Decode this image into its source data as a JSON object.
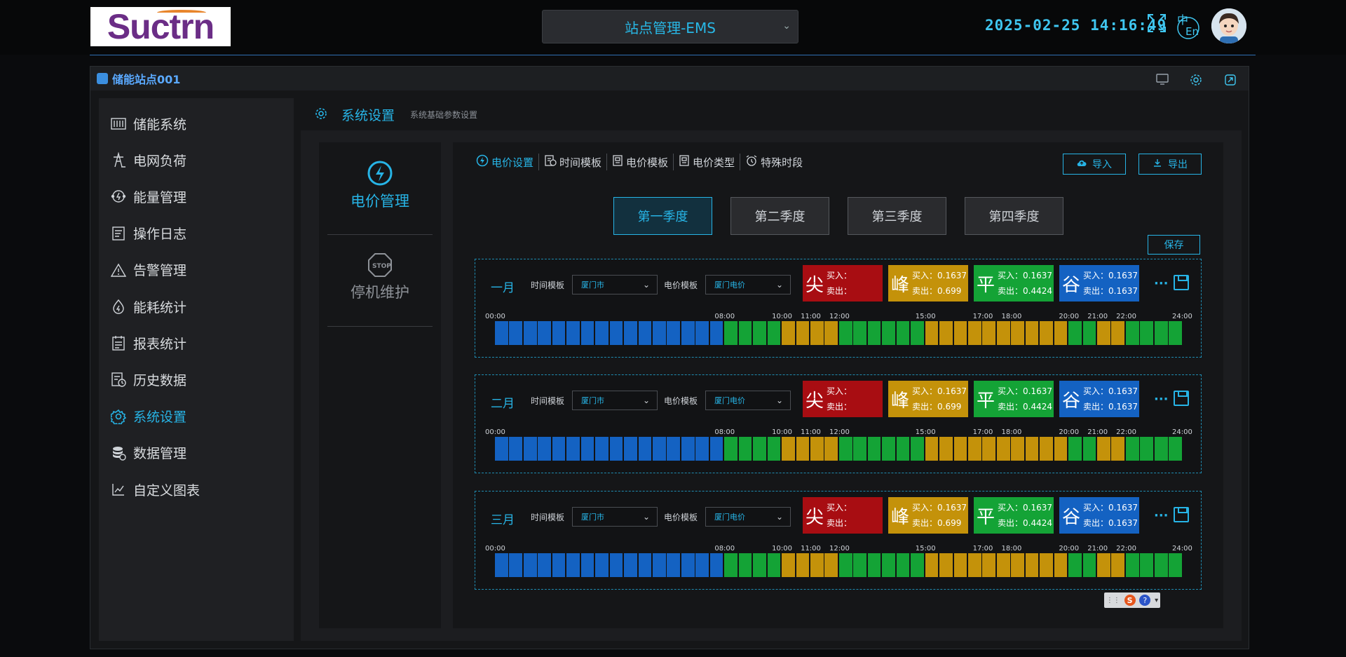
{
  "logo": {
    "text": "Suctrn"
  },
  "header": {
    "site_select": "站点管理-EMS",
    "datetime": "2025-02-25  14:16:49",
    "lang_icon": "中/En",
    "icons": [
      "fullscreen-icon",
      "language-icon",
      "avatar"
    ]
  },
  "station": {
    "title": "储能站点001",
    "icons": [
      "monitor-icon",
      "gear-icon",
      "copy-icon"
    ]
  },
  "sidebar": {
    "items": [
      {
        "label": "储能系统",
        "icon": "battery-icon"
      },
      {
        "label": "电网负荷",
        "icon": "tower-icon"
      },
      {
        "label": "能量管理",
        "icon": "cycle-icon"
      },
      {
        "label": "操作日志",
        "icon": "log-icon"
      },
      {
        "label": "告警管理",
        "icon": "warning-icon"
      },
      {
        "label": "能耗统计",
        "icon": "energy-icon"
      },
      {
        "label": "报表统计",
        "icon": "report-icon"
      },
      {
        "label": "历史数据",
        "icon": "history-icon"
      },
      {
        "label": "系统设置",
        "icon": "gear-icon",
        "active": true
      },
      {
        "label": "数据管理",
        "icon": "database-icon"
      },
      {
        "label": "自定义图表",
        "icon": "chart-icon"
      }
    ]
  },
  "main": {
    "title": "系统设置",
    "subtitle": "系统基础参数设置"
  },
  "leftmenu": {
    "items": [
      {
        "label": "电价管理",
        "icon": "lightning-icon",
        "active": true
      },
      {
        "label": "停机维护",
        "icon": "stop-icon",
        "active": false
      }
    ]
  },
  "tabs": [
    {
      "label": "电价设置",
      "active": true
    },
    {
      "label": "时间模板"
    },
    {
      "label": "电价模板"
    },
    {
      "label": "电价类型"
    },
    {
      "label": "特殊时段"
    }
  ],
  "actions": {
    "import": "导入",
    "export": "导出",
    "save": "保存"
  },
  "quarters": [
    {
      "label": "第一季度",
      "active": true
    },
    {
      "label": "第二季度"
    },
    {
      "label": "第三季度"
    },
    {
      "label": "第四季度"
    }
  ],
  "field_labels": {
    "time_template": "时间模板",
    "price_template": "电价模板"
  },
  "price_types": {
    "sharp": {
      "label": "尖",
      "color": "#a80d12",
      "buy_label": "买入：",
      "sell_label": "卖出：",
      "buy": "",
      "sell": ""
    },
    "peak": {
      "label": "峰",
      "color": "#c4920a",
      "buy_label": "买入：",
      "sell_label": "卖出：",
      "buy": "0.1637",
      "sell": "0.699"
    },
    "flat": {
      "label": "平",
      "color": "#14a336",
      "buy_label": "买入：",
      "sell_label": "卖出：",
      "buy": "0.1637",
      "sell": "0.4424"
    },
    "valley": {
      "label": "谷",
      "color": "#1462c2",
      "buy_label": "买入：",
      "sell_label": "卖出：",
      "buy": "0.1637",
      "sell": "0.1637"
    }
  },
  "time_ticks": [
    "00:00",
    "08:00",
    "10:00",
    "11:00",
    "12:00",
    "15:00",
    "17:00",
    "18:00",
    "20:00",
    "21:00",
    "22:00",
    "24:00"
  ],
  "months": [
    {
      "name": "一月",
      "time_template": "厦门市",
      "price_template": "厦门电价"
    },
    {
      "name": "二月",
      "time_template": "厦门市",
      "price_template": "厦门电价"
    },
    {
      "name": "三月",
      "time_template": "厦门市",
      "price_template": "厦门电价"
    }
  ],
  "schedule_colors": {
    "valley": "#1462c2",
    "flat": "#14a336",
    "peak": "#c4920a"
  },
  "schedule": [
    {
      "start": "00:00",
      "end": "08:00",
      "type": "valley"
    },
    {
      "start": "08:00",
      "end": "10:00",
      "type": "flat"
    },
    {
      "start": "10:00",
      "end": "12:00",
      "type": "peak"
    },
    {
      "start": "12:00",
      "end": "15:00",
      "type": "flat"
    },
    {
      "start": "15:00",
      "end": "20:00",
      "type": "peak"
    },
    {
      "start": "20:00",
      "end": "21:00",
      "type": "flat"
    },
    {
      "start": "21:00",
      "end": "22:00",
      "type": "peak"
    },
    {
      "start": "22:00",
      "end": "24:00",
      "type": "flat"
    }
  ]
}
